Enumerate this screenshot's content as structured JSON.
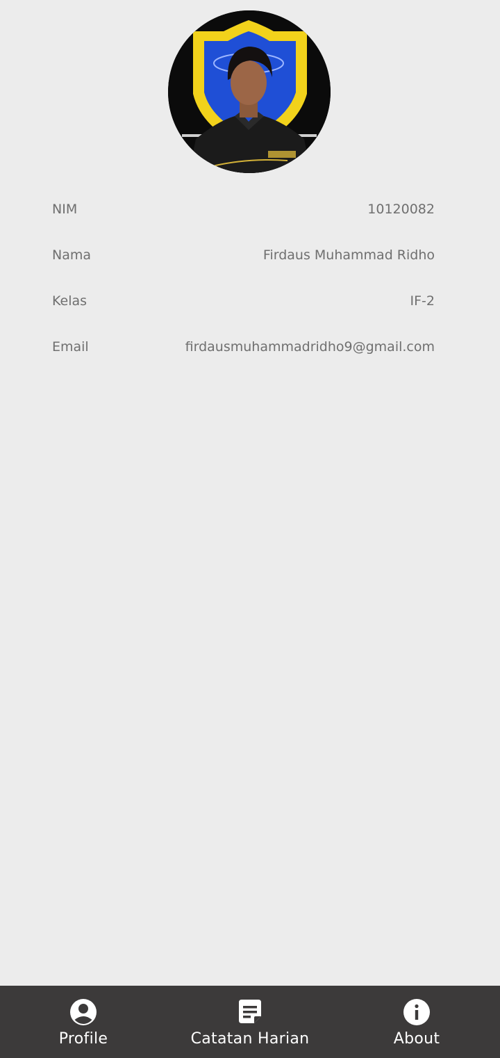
{
  "profile": {
    "fields": [
      {
        "label": "NIM",
        "value": "10120082"
      },
      {
        "label": "Nama",
        "value": "Firdaus Muhammad Ridho"
      },
      {
        "label": "Kelas",
        "value": "IF-2"
      },
      {
        "label": "Email",
        "value": "firdausmuhammadridho9@gmail.com"
      }
    ]
  },
  "nav": {
    "items": [
      {
        "label": "Profile",
        "icon": "account-circle-icon"
      },
      {
        "label": "Catatan Harian",
        "icon": "note-icon"
      },
      {
        "label": "About",
        "icon": "info-icon"
      }
    ]
  },
  "colors": {
    "background": "#ececec",
    "nav_background": "#3c3a3a",
    "text_muted": "#6f6f6f",
    "logo_yellow": "#f2d21b",
    "logo_blue": "#1f4fd6"
  }
}
